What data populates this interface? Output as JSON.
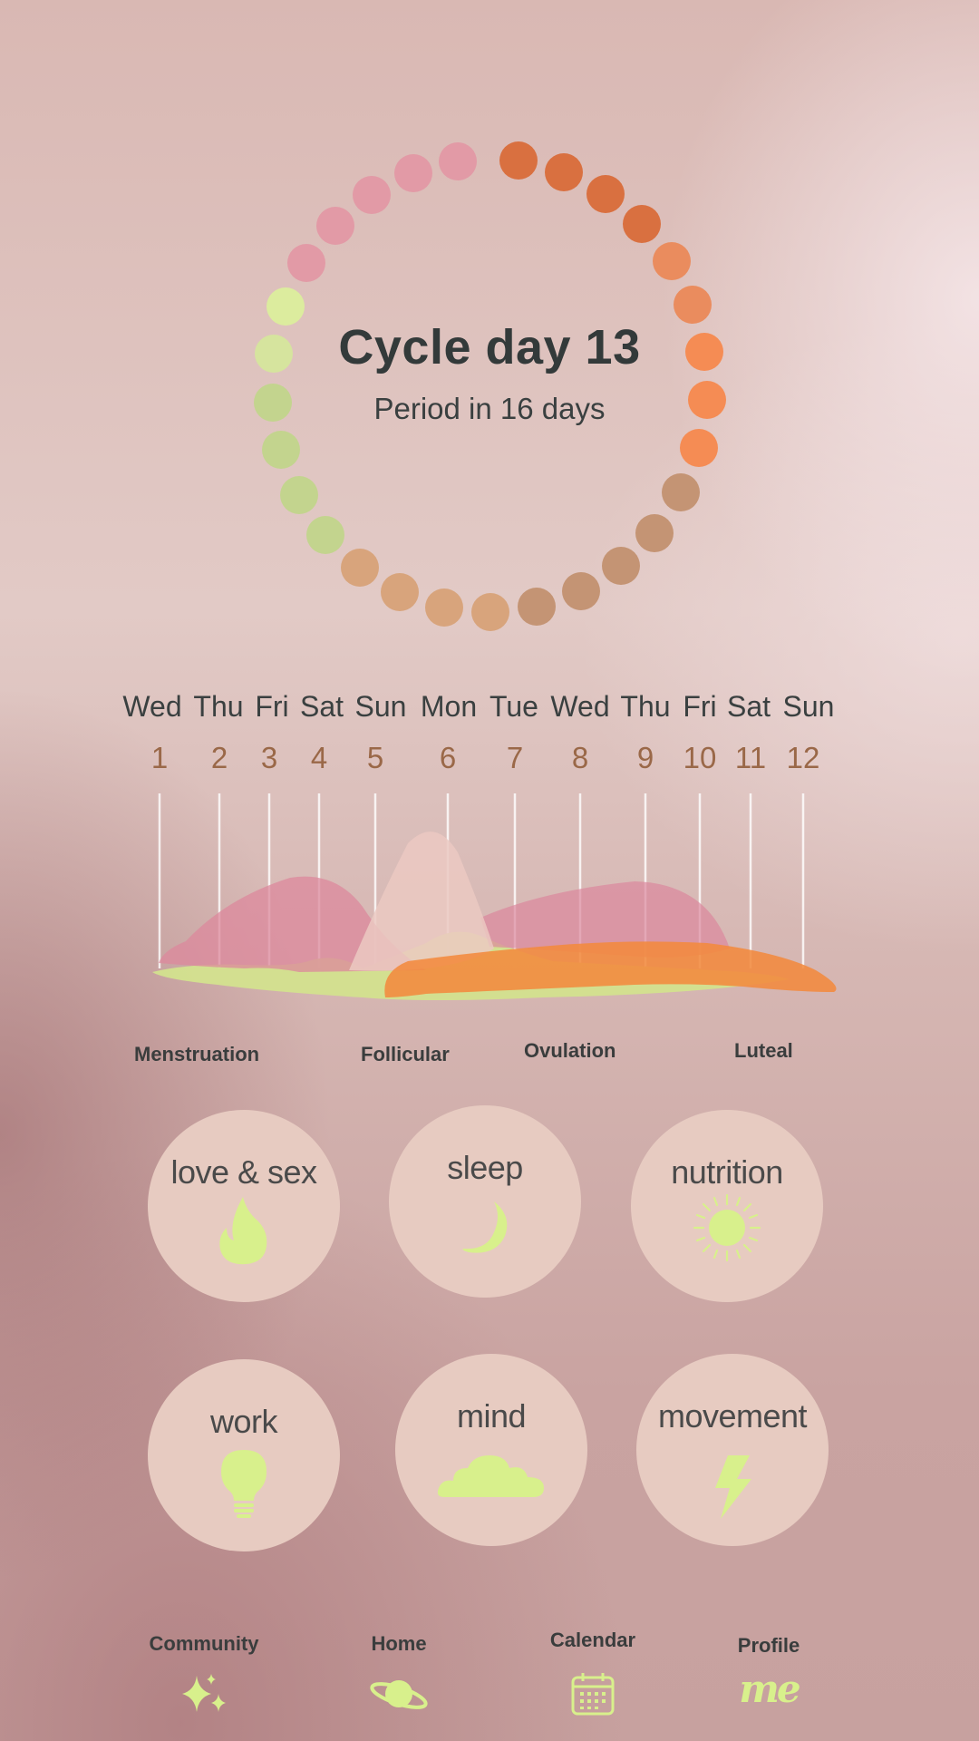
{
  "cycle": {
    "title": "Cycle day 13",
    "subtitle": "Period in 16 days",
    "dot_colors": [
      "#e29aa6",
      "#e29aa6",
      "#e29aa6",
      "#e29aa6",
      "#e29aa6",
      "#dcec9e",
      "#d6e49e",
      "#c3d48e",
      "#c3d48e",
      "#c3d48e",
      "#c3d48e",
      "#d8a47c",
      "#d8a47c",
      "#d8a47c",
      "#d8a47c",
      "#c49474",
      "#c49474",
      "#c49474",
      "#c49474",
      "#c49474",
      "#f58c54",
      "#f58c54",
      "#f58c54",
      "#ea8c5e",
      "#ea8c5e",
      "#d97040",
      "#d97040",
      "#d97040",
      "#d97040"
    ]
  },
  "timeline": {
    "days": [
      "Wed",
      "Thu",
      "Fri",
      "Sat",
      "Sun",
      "Mon",
      "Tue",
      "Wed",
      "Thu",
      "Fri",
      "Sat",
      "Sun"
    ],
    "numbers": [
      "1",
      "2",
      "3",
      "4",
      "5",
      "6",
      "7",
      "8",
      "9",
      "10",
      "11",
      "12"
    ],
    "phases": {
      "menstruation": "Menstruation",
      "follicular": "Follicular",
      "ovulation": "Ovulation",
      "luteal": "Luteal"
    }
  },
  "categories": {
    "love": "love & sex",
    "sleep": "sleep",
    "nutrition": "nutrition",
    "work": "work",
    "mind": "mind",
    "movement": "movement"
  },
  "nav": {
    "community": "Community",
    "home": "Home",
    "calendar": "Calendar",
    "profile": "Profile",
    "profile_icon_text": "me"
  },
  "colors": {
    "accent_lime": "#d8f08c",
    "tile_bg": "#e7cbc1",
    "text_dark": "#333a3a",
    "day_number": "#9a6848"
  }
}
